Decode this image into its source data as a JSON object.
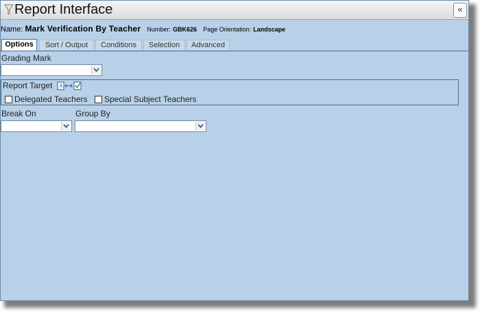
{
  "window": {
    "title": "Report Interface"
  },
  "report": {
    "name_label": "Name:",
    "name_value": "Mark Verification By Teacher",
    "number_label": "Number:",
    "number_value": "GBK626",
    "orientation_label": "Page Orientation:",
    "orientation_value": "Landscape"
  },
  "tabs": [
    {
      "label": "Options",
      "active": true
    },
    {
      "label": "Sort / Output",
      "active": false
    },
    {
      "label": "Conditions",
      "active": false
    },
    {
      "label": "Selection",
      "active": false
    },
    {
      "label": "Advanced",
      "active": false
    }
  ],
  "options": {
    "grading_mark": {
      "label": "Grading Mark",
      "value": ""
    },
    "report_target": {
      "label": "Report Target",
      "checkboxes": [
        {
          "label": "Delegated Teachers",
          "checked": false
        },
        {
          "label": "Special Subject Teachers",
          "checked": false
        }
      ]
    },
    "break_on": {
      "label": "Break On",
      "value": ""
    },
    "group_by": {
      "label": "Group By",
      "value": ""
    }
  }
}
